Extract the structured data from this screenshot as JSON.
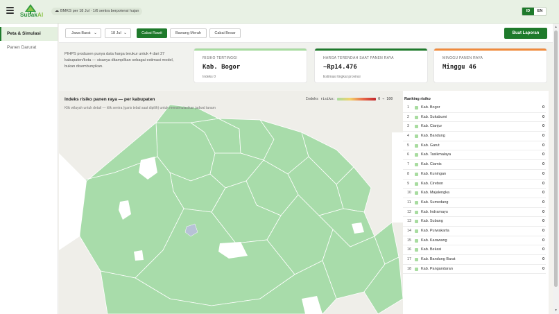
{
  "app": {
    "logo_text": "Subak",
    "logo_text_accent": "AI",
    "bmkg_status": "BMKG per 18 Jul · 1/6 sentra berpotensi hujan",
    "lang_id": "ID",
    "lang_en": "EN",
    "active_lang": "ID",
    "brand_color": "#1e7a2b"
  },
  "sidebar": {
    "items": [
      {
        "label": "Peta & Simulasi",
        "active": true
      },
      {
        "label": "Panen Darurat",
        "active": false
      }
    ]
  },
  "toolbar": {
    "province": "Jawa Barat",
    "date": "18 Jul",
    "commodities": [
      {
        "label": "Cabai Rawit",
        "selected": true
      },
      {
        "label": "Bawang Merah",
        "selected": false
      },
      {
        "label": "Cabai Besar",
        "selected": false
      }
    ],
    "report_button": "Buat Laporan"
  },
  "info": {
    "note": "PIHPS produsen punya data harga terukur untuk 4 dari 27 kabupaten/kota — sisanya ditampilkan sebagai estimasi model, bukan disembunyikan.",
    "cards": [
      {
        "label": "RISIKO TERTINGGI",
        "value": "Kab. Bogor",
        "sub": "Indeks 0",
        "accent": "#a8dca0"
      },
      {
        "label": "HARGA TERENDAH SAAT PANEN RAYA",
        "value": "~Rp14.476",
        "sub": "Estimasi tingkat provinsi",
        "accent": "#1e7a2b"
      },
      {
        "label": "MINGGU PANEN RAYA",
        "value": "Minggu 46",
        "sub": "",
        "accent": "#f08a3c"
      }
    ]
  },
  "map": {
    "title": "Indeks risiko panen raya — per kabupaten",
    "subtitle": "Klik wilayah untuk detail — klik sentra (garis tebal saat dipilih) untuk mensimulasikan jadwal tanam",
    "legend_label": "Indeks risiko:",
    "legend_range": "0 → 100",
    "fill_color": "#a8dcaa",
    "border_color": "#ffffff"
  },
  "ranking": {
    "title": "Ranking risiko",
    "rows": [
      {
        "rank": "1",
        "name": "Kab. Bogor",
        "score": "0"
      },
      {
        "rank": "2",
        "name": "Kab. Sukabumi",
        "score": "0"
      },
      {
        "rank": "3",
        "name": "Kab. Cianjur",
        "score": "0"
      },
      {
        "rank": "4",
        "name": "Kab. Bandung",
        "score": "0"
      },
      {
        "rank": "5",
        "name": "Kab. Garut",
        "score": "0"
      },
      {
        "rank": "6",
        "name": "Kab. Tasikmalaya",
        "score": "0"
      },
      {
        "rank": "7",
        "name": "Kab. Ciamis",
        "score": "0"
      },
      {
        "rank": "8",
        "name": "Kab. Kuningan",
        "score": "0"
      },
      {
        "rank": "9",
        "name": "Kab. Cirebon",
        "score": "0"
      },
      {
        "rank": "10",
        "name": "Kab. Majalengka",
        "score": "0"
      },
      {
        "rank": "11",
        "name": "Kab. Sumedang",
        "score": "0"
      },
      {
        "rank": "12",
        "name": "Kab. Indramayu",
        "score": "0"
      },
      {
        "rank": "13",
        "name": "Kab. Subang",
        "score": "0"
      },
      {
        "rank": "14",
        "name": "Kab. Purwakarta",
        "score": "0"
      },
      {
        "rank": "15",
        "name": "Kab. Karawang",
        "score": "0"
      },
      {
        "rank": "16",
        "name": "Kab. Bekasi",
        "score": "0"
      },
      {
        "rank": "17",
        "name": "Kab. Bandung Barat",
        "score": "0"
      },
      {
        "rank": "18",
        "name": "Kab. Pangandaran",
        "score": "0"
      }
    ]
  }
}
